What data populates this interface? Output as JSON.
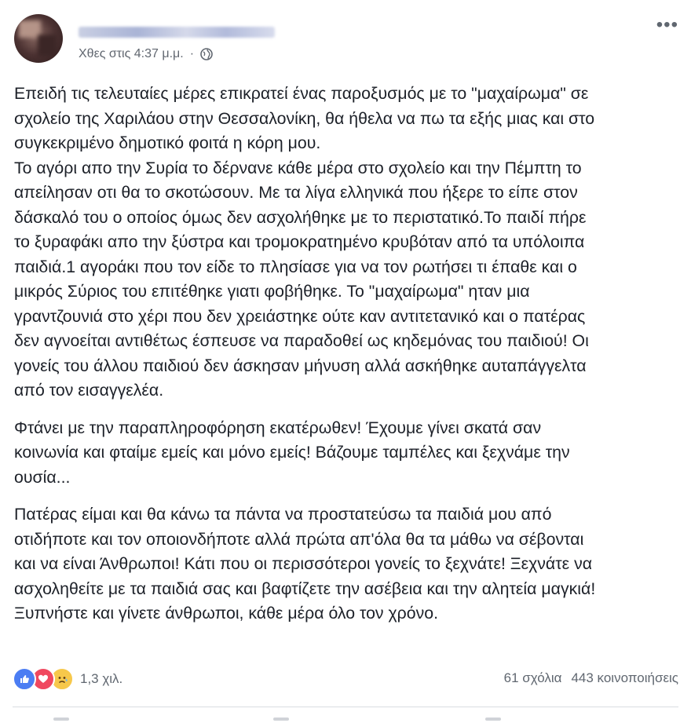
{
  "header": {
    "timestamp": "Χθες στις 4:37 μ.μ.",
    "separator": "·",
    "more": "•••"
  },
  "post": {
    "paragraphs": [
      {
        "lines": [
          "Επειδή τις τελευταίες μέρες επικρατεί ένας παροξυσμός με το \"μαχαίρωμα\" σε",
          "σχολείο της Χαριλάου στην Θεσσαλονίκη, θα ήθελα να πω τα εξής μιας και στο",
          "συγκεκριμένο δημοτικό φοιτά η κόρη μου.",
          "Το αγόρι απο την Συρία το δέρνανε κάθε μέρα στο σχολείο και την Πέμπτη το",
          "απείλησαν οτι θα το σκοτώσουν. Με τα λίγα ελληνικά που ήξερε το είπε στον",
          "δάσκαλό του ο οποίος όμως δεν ασχολήθηκε με το περιστατικό.Το παιδί πήρε",
          "το ξυραφάκι απο την ξύστρα και τρομοκρατημένο κρυβόταν από τα υπόλοιπα",
          "παιδιά.1 αγοράκι που τον είδε το πλησίασε για να τον ρωτήσει τι έπαθε και ο",
          "μικρός Σύριος του επιτέθηκε γιατι φοβήθηκε. Το \"μαχαίρωμα\" ηταν μια",
          "γραντζουνιά στο χέρι που δεν χρειάστηκε ούτε καν αντιτετανικό και ο πατέρας",
          "δεν αγνοείται αντιθέτως έσπευσε να παραδοθεί ως κηδεμόνας του παιδιού! Οι",
          "γονείς του άλλου παιδιού δεν άσκησαν μήνυση αλλά ασκήθηκε αυταπάγγελτα",
          "από τον εισαγγελέα."
        ]
      },
      {
        "lines": [
          "Φτάνει με την παραπληροφόρηση εκατέρωθεν! Έχουμε γίνει σκατά σαν",
          "κοινωνία και φταίμε εμείς και μόνο εμείς! Βάζουμε ταμπέλες και ξεχνάμε την",
          "ουσία..."
        ]
      },
      {
        "lines": [
          "Πατέρας είμαι και θα κάνω τα πάντα να προστατεύσω τα παιδιά μου από",
          "οτιδήποτε και τον οποιονδήποτε αλλά πρώτα απ'όλα θα τα μάθω να σέβονται",
          "και να είναι Άνθρωποι! Κάτι που οι περισσότεροι γονείς το ξεχνάτε! Ξεχνάτε να",
          "ασχοληθείτε με τα παιδιά σας και βαφτίζετε την ασέβεια και την αλητεία μαγκιά!",
          "Ξυπνήστε και γίνετε άνθρωποι, κάθε μέρα όλο τον χρόνο."
        ]
      }
    ]
  },
  "footer": {
    "reactions": [
      "like-icon",
      "love-icon",
      "sad-icon"
    ],
    "reaction_count": "1,3 χιλ.",
    "comments": "61 σχόλια",
    "shares": "443 κοινοποιήσεις"
  },
  "colors": {
    "text": "#1d2129",
    "secondary_text": "#616770",
    "like": "#4b7df3",
    "love": "#f0485f",
    "sad": "#f7c84b"
  }
}
